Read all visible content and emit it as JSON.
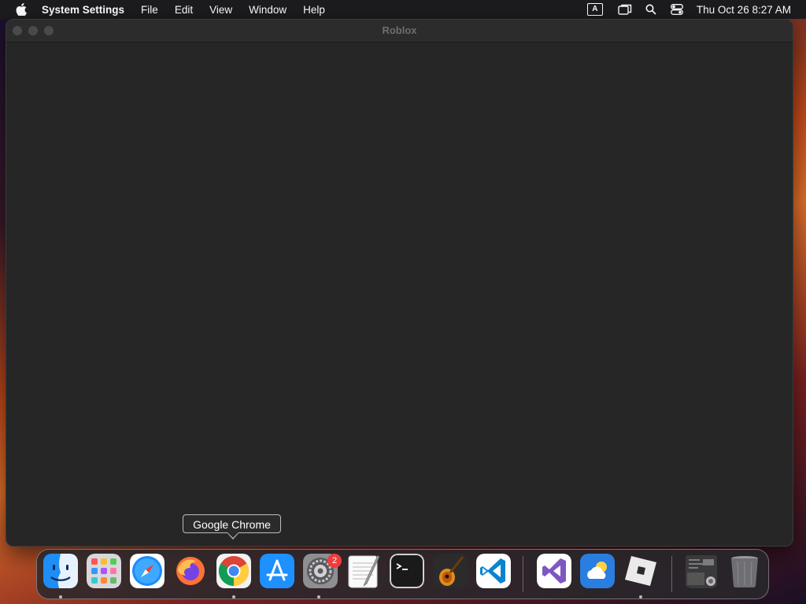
{
  "menubar": {
    "app_name": "System Settings",
    "menus": [
      "File",
      "Edit",
      "View",
      "Window",
      "Help"
    ],
    "input_indicator": "A",
    "clock": "Thu Oct 26  8:27 AM"
  },
  "window": {
    "title": "Roblox"
  },
  "tooltip": {
    "text": "Google Chrome"
  },
  "dock": {
    "items": [
      {
        "name": "Finder",
        "icon": "finder-icon",
        "running": true
      },
      {
        "name": "Launchpad",
        "icon": "launchpad-icon",
        "running": false
      },
      {
        "name": "Safari",
        "icon": "safari-icon",
        "running": false
      },
      {
        "name": "Firefox",
        "icon": "firefox-icon",
        "running": false
      },
      {
        "name": "Google Chrome",
        "icon": "chrome-icon",
        "running": true
      },
      {
        "name": "App Store",
        "icon": "app-store-icon",
        "running": false
      },
      {
        "name": "System Settings",
        "icon": "system-settings-icon",
        "running": true,
        "badge": "2"
      },
      {
        "name": "TextEdit",
        "icon": "textedit-icon",
        "running": false
      },
      {
        "name": "Terminal",
        "icon": "terminal-icon",
        "running": false
      },
      {
        "name": "GarageBand",
        "icon": "garageband-icon",
        "running": false
      },
      {
        "name": "Visual Studio Code",
        "icon": "vscode-icon",
        "running": false
      },
      {
        "name": "Visual Studio",
        "icon": "visual-studio-icon",
        "running": false
      },
      {
        "name": "Weather",
        "icon": "weather-icon",
        "running": false
      },
      {
        "name": "Roblox",
        "icon": "roblox-icon",
        "running": true
      },
      {
        "name": "Downloads",
        "icon": "downloads-stack-icon",
        "running": false
      },
      {
        "name": "Trash",
        "icon": "trash-icon",
        "running": false
      }
    ]
  }
}
